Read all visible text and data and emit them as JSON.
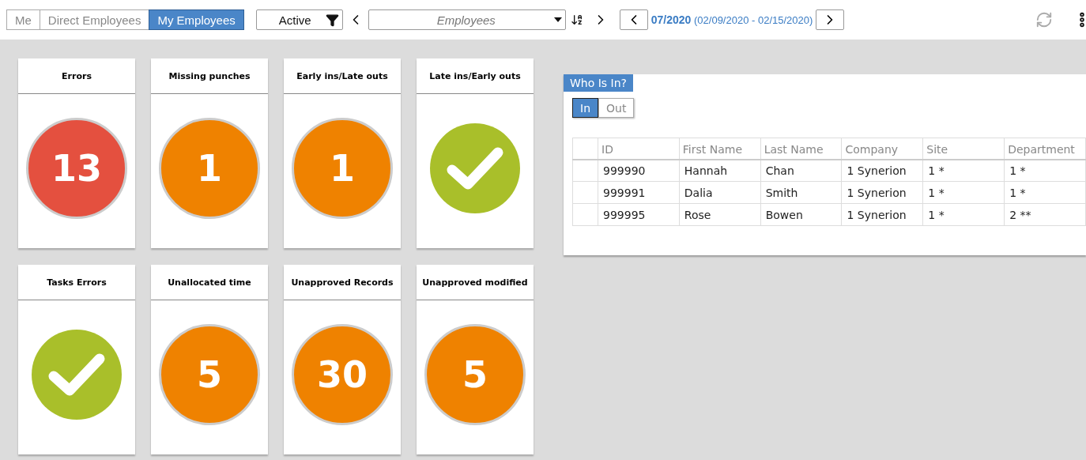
{
  "toolbar": {
    "scope_tabs": [
      {
        "label": "Me",
        "selected": false
      },
      {
        "label": "Direct Employees",
        "selected": false
      },
      {
        "label": "My Employees",
        "selected": true
      }
    ],
    "status_filter": "Active",
    "employee_select": {
      "placeholder": "Employees"
    },
    "period": {
      "label": "07/2020",
      "range": "(02/09/2020 - 02/15/2020)"
    }
  },
  "tiles": [
    {
      "title": "Errors",
      "kind": "count",
      "value": "13",
      "color": "#e4503f"
    },
    {
      "title": "Missing punches",
      "kind": "count",
      "value": "1",
      "color": "#ef8200"
    },
    {
      "title": "Early ins/Late outs",
      "kind": "count",
      "value": "1",
      "color": "#ef8200"
    },
    {
      "title": "Late ins/Early outs",
      "kind": "ok",
      "color": "#a9bf2a"
    },
    {
      "title": "Tasks Errors",
      "kind": "ok",
      "color": "#a9bf2a"
    },
    {
      "title": "Unallocated time",
      "kind": "count",
      "value": "5",
      "color": "#ef8200"
    },
    {
      "title": "Unapproved Records",
      "kind": "count",
      "value": "30",
      "color": "#ef8200"
    },
    {
      "title": "Unapproved modified",
      "kind": "count",
      "value": "5",
      "color": "#ef8200"
    }
  ],
  "who_is_in": {
    "title": "Who Is In?",
    "toggle": [
      {
        "label": "In",
        "selected": true
      },
      {
        "label": "Out",
        "selected": false
      }
    ],
    "table": {
      "columns": [
        "ID",
        "First Name",
        "Last Name",
        "Company",
        "Site",
        "Department"
      ],
      "rows": [
        [
          "999990",
          "Hannah",
          "Chan",
          "1 Synerion",
          "1 *",
          "1 *"
        ],
        [
          "999991",
          "Dalia",
          "Smith",
          "1 Synerion",
          "1 *",
          "1 *"
        ],
        [
          "999995",
          "Rose",
          "Bowen",
          "1 Synerion",
          "1 *",
          "2 **"
        ]
      ]
    }
  }
}
